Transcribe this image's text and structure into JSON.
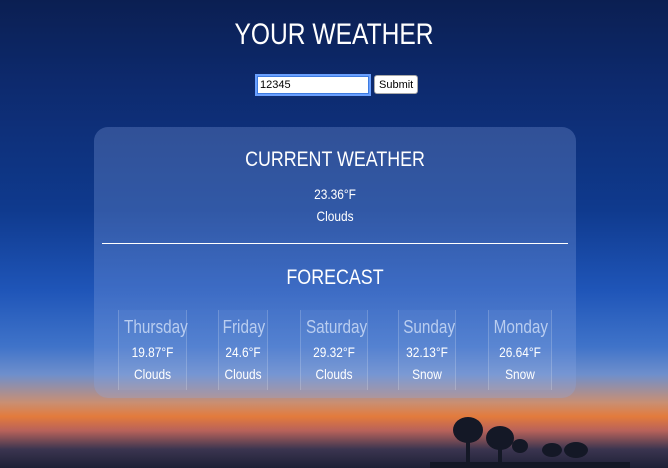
{
  "header": {
    "title": "YOUR WEATHER"
  },
  "form": {
    "zip_value": "12345",
    "submit_label": "Submit"
  },
  "current": {
    "title": "CURRENT WEATHER",
    "temp": "23.36°F",
    "description": "Clouds"
  },
  "forecast": {
    "title": "FORECAST",
    "days": [
      {
        "day": "Thursday",
        "temp": "19.87°F",
        "description": "Clouds"
      },
      {
        "day": "Friday",
        "temp": "24.6°F",
        "description": "Clouds"
      },
      {
        "day": "Saturday",
        "temp": "29.32°F",
        "description": "Clouds"
      },
      {
        "day": "Sunday",
        "temp": "32.13°F",
        "description": "Snow"
      },
      {
        "day": "Monday",
        "temp": "26.64°F",
        "description": "Snow"
      }
    ]
  }
}
